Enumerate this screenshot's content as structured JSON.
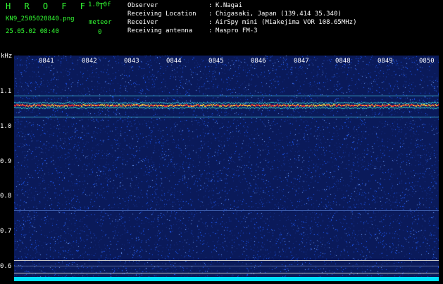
{
  "header": {
    "brand": "H R O F F T",
    "version": "1.0.0f",
    "filename": "KN9_2505020840.png",
    "datetime": "25.05.02 08:40",
    "meteor_label": "meteor",
    "meteor_count": "0"
  },
  "info": [
    {
      "key": "Observer",
      "value": "K.Nagai"
    },
    {
      "key": "Receiving Location",
      "value": "Chigasaki, Japan (139.414 35.340)"
    },
    {
      "key": "Receiver",
      "value": "AirSpy mini (Miakejima VOR 108.65MHz)"
    },
    {
      "key": "Receiving antenna",
      "value": "Maspro FM-3"
    }
  ],
  "spectrogram": {
    "y_unit": "kHz",
    "y_ticks": [
      "1.1",
      "1.0",
      "0.9",
      "0.8",
      "0.7",
      "0.6"
    ],
    "x_ticks": [
      "0841",
      "0842",
      "0843",
      "0844",
      "0845",
      "0846",
      "0847",
      "0848",
      "0849",
      "0850"
    ],
    "carrier_color": "#ff3030",
    "background_color": "#0a1a5a",
    "noise_color": "#1e5cff"
  }
}
